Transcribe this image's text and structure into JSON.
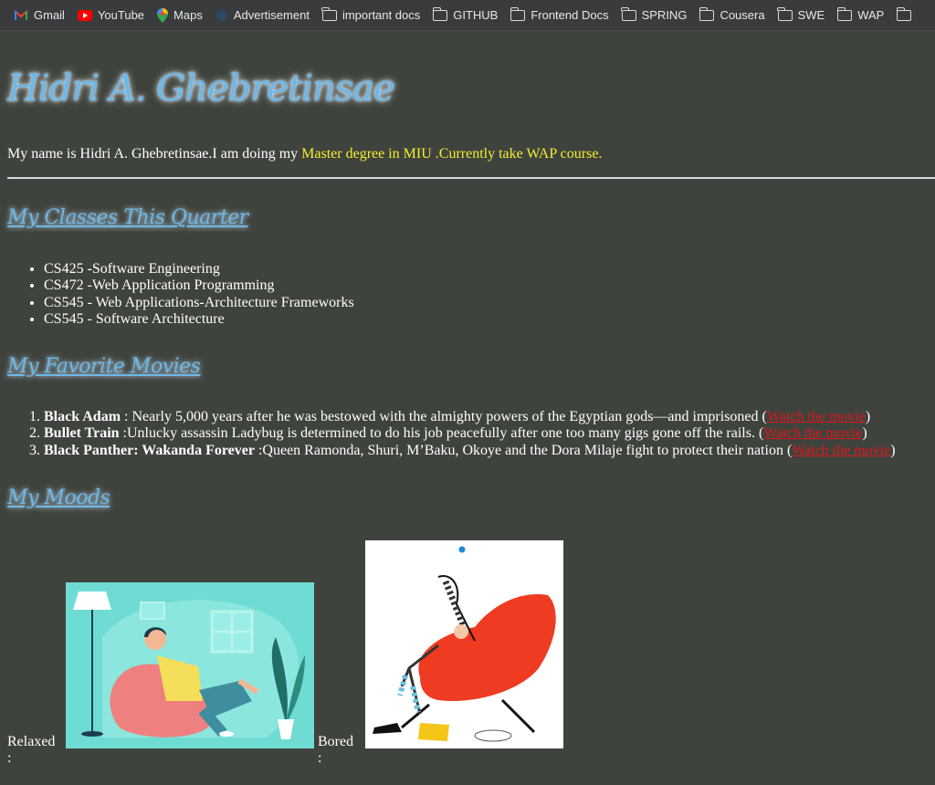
{
  "bookmarks": [
    {
      "label": "Gmail",
      "icon": "gmail-icon"
    },
    {
      "label": "YouTube",
      "icon": "youtube-icon"
    },
    {
      "label": "Maps",
      "icon": "maps-icon"
    },
    {
      "label": "Advertisement",
      "icon": "globe-icon"
    },
    {
      "label": "important docs",
      "icon": "folder-icon"
    },
    {
      "label": "GITHUB",
      "icon": "folder-icon"
    },
    {
      "label": "Frontend Docs",
      "icon": "folder-icon"
    },
    {
      "label": "SPRING",
      "icon": "folder-icon"
    },
    {
      "label": "Cousera",
      "icon": "folder-icon"
    },
    {
      "label": "SWE",
      "icon": "folder-icon"
    },
    {
      "label": "WAP",
      "icon": "folder-icon"
    }
  ],
  "page": {
    "title": "Hidri A. Ghebretinsae",
    "intro_plain": "My name is Hidri A. Ghebretinsae.I am doing my ",
    "intro_highlight": "Master degree in MIU .Currently take WAP course."
  },
  "classes": {
    "heading": "My Classes This Quarter",
    "items": [
      "CS425 -Software Engineering",
      "CS472 -Web Application Programming",
      "CS545 - Web Applications-Architecture Frameworks",
      "CS545 - Software Architecture"
    ]
  },
  "movies": {
    "heading": "My Favorite Movies",
    "link_text": "Watch the movie",
    "items": [
      {
        "name": "Black Adam",
        "desc": " : Nearly 5,000 years after he was bestowed with the almighty powers of the Egyptian gods—and imprisoned ("
      },
      {
        "name": "Bullet Train",
        "desc": " :Unlucky assassin Ladybug is determined to do his job peacefully after one too many gigs gone off the rails. ("
      },
      {
        "name": "Black Panther: Wakanda Forever",
        "desc": " :Queen Ramonda, Shuri, M’Baku, Okoye and the Dora Milaje fight to protect their nation ("
      }
    ],
    "close_paren": ")"
  },
  "moods": {
    "heading": "My Moods",
    "relaxed_label": "Relaxed :",
    "bored_label": "Bored :"
  },
  "colors": {
    "background": "#3f433d",
    "heading": "#6cb8ea",
    "highlight": "#f5ee2e",
    "link": "#e0151b"
  }
}
